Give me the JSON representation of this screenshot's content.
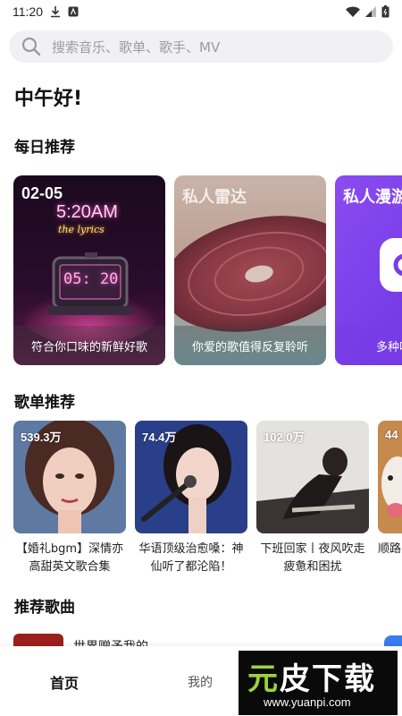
{
  "status_bar": {
    "time": "11:20"
  },
  "search": {
    "placeholder": "搜索音乐、歌单、歌手、MV"
  },
  "greeting": "中午好!",
  "daily": {
    "title": "每日推荐",
    "cards": [
      {
        "head": "02-05",
        "caption": "符合你口味的新鲜好歌",
        "art_text_time": "5:20AM",
        "art_text_clock": "05: 20",
        "art_text_script": "the lyrics"
      },
      {
        "head": "私人雷达",
        "caption": "你爱的歌值得反复聆听"
      },
      {
        "head": "私人漫游",
        "caption": "多种听歌模式"
      }
    ]
  },
  "playlists": {
    "title": "歌单推荐",
    "items": [
      {
        "count": "539.3万",
        "title": "【婚礼bgm】深情亦高甜英文歌合集"
      },
      {
        "count": "74.4万",
        "title": "华语顶级治愈嗓：神仙听了都沦陷！"
      },
      {
        "count": "102.0万",
        "title": "下班回家丨夜风吹走疲惫和困扰"
      },
      {
        "count": "44",
        "title": "顺路"
      }
    ]
  },
  "songs": {
    "title": "推荐歌曲",
    "first_title": "世界赠予我的"
  },
  "bottom_nav": {
    "home": "首页",
    "mine": "我的"
  },
  "watermark": {
    "logo_green": "元",
    "logo_white": "皮下载",
    "url": "www.yuanpi.com"
  }
}
